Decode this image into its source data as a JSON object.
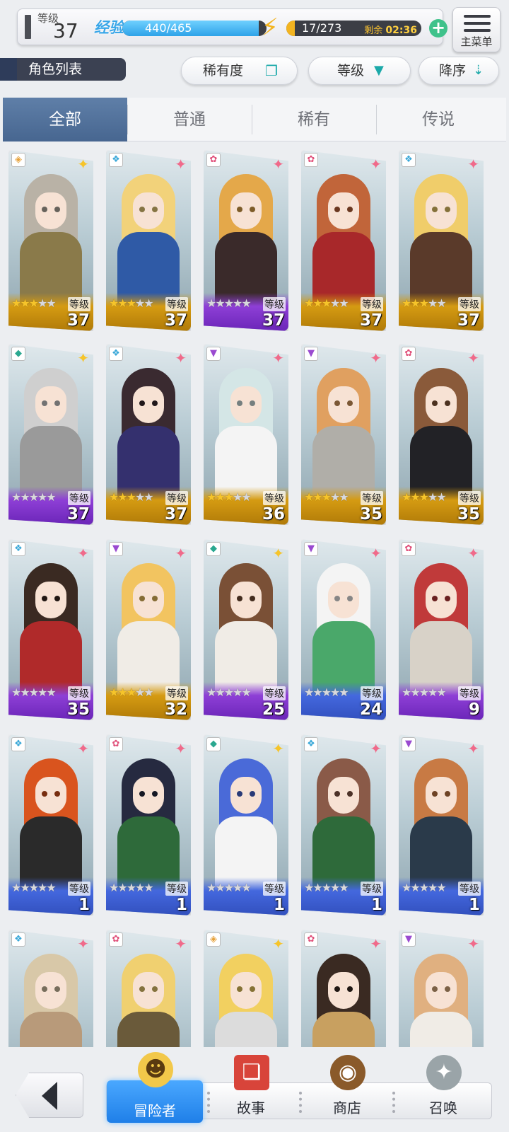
{
  "status": {
    "level_label": "等级",
    "level_value": "37",
    "exp_label": "经验",
    "exp_text": "440/465",
    "exp_fraction": 0.946,
    "stamina_text": "17/273",
    "stamina_fraction": 0.062,
    "stamina_remain_label": "剩余",
    "stamina_remain_time": "02:36",
    "add_symbol": "+"
  },
  "menu": {
    "label": "主菜单",
    "icon": "hamburger-icon"
  },
  "toolbar": {
    "section_label": "角色列表",
    "rarity_label": "稀有度",
    "level_sort_label": "等级",
    "order_label": "降序"
  },
  "tabs": [
    {
      "label": "全部",
      "active": true
    },
    {
      "label": "普通",
      "active": false
    },
    {
      "label": "稀有",
      "active": false
    },
    {
      "label": "传说",
      "active": false
    }
  ],
  "card_level_label": "等级",
  "cards": [
    {
      "level": "37",
      "stars": 3,
      "frame": "rare",
      "element": "earth",
      "hair": "#b9b2a6",
      "outfit": "#8a7a4a"
    },
    {
      "level": "37",
      "stars": 3,
      "frame": "rare",
      "element": "water",
      "hair": "#f2d27a",
      "outfit": "#2f5aa6"
    },
    {
      "level": "37",
      "stars": 0,
      "frame": "legend",
      "element": "fire",
      "hair": "#e4a84a",
      "outfit": "#3a2a2a"
    },
    {
      "level": "37",
      "stars": 3,
      "frame": "rare",
      "element": "fire",
      "hair": "#c1653a",
      "outfit": "#a8282a"
    },
    {
      "level": "37",
      "stars": 3,
      "frame": "rare",
      "element": "water",
      "hair": "#f0cd6a",
      "outfit": "#5a3a2a"
    },
    {
      "level": "37",
      "stars": 0,
      "frame": "legend",
      "element": "wind",
      "hair": "#cfcfcf",
      "outfit": "#9a9a9a"
    },
    {
      "level": "37",
      "stars": 3,
      "frame": "rare",
      "element": "water",
      "hair": "#3a2a30",
      "outfit": "#34306e"
    },
    {
      "level": "36",
      "stars": 3,
      "frame": "rare",
      "element": "dark",
      "hair": "#d4e6e6",
      "outfit": "#f4f4f4"
    },
    {
      "level": "35",
      "stars": 3,
      "frame": "rare",
      "element": "dark",
      "hair": "#e0a060",
      "outfit": "#b0aea8"
    },
    {
      "level": "35",
      "stars": 3,
      "frame": "rare",
      "element": "fire",
      "hair": "#8a5a3a",
      "outfit": "#222226"
    },
    {
      "level": "35",
      "stars": 0,
      "frame": "legend",
      "element": "water",
      "hair": "#3a2a22",
      "outfit": "#b02a2a"
    },
    {
      "level": "32",
      "stars": 3,
      "frame": "rare",
      "element": "dark",
      "hair": "#f2c460",
      "outfit": "#f0ece6"
    },
    {
      "level": "25",
      "stars": 0,
      "frame": "legend",
      "element": "wind",
      "hair": "#7a5036",
      "outfit": "#f0ece6"
    },
    {
      "level": "24",
      "stars": 0,
      "frame": "blue",
      "element": "dark",
      "hair": "#f4f4f4",
      "outfit": "#4aa86a"
    },
    {
      "level": "9",
      "stars": 0,
      "frame": "legend",
      "element": "fire",
      "hair": "#c03a3a",
      "outfit": "#d8d2c8"
    },
    {
      "level": "1",
      "stars": 0,
      "frame": "blue",
      "element": "water",
      "hair": "#d9541e",
      "outfit": "#2a2a2a"
    },
    {
      "level": "1",
      "stars": 0,
      "frame": "blue",
      "element": "fire",
      "hair": "#262a40",
      "outfit": "#2e6a3a"
    },
    {
      "level": "1",
      "stars": 0,
      "frame": "blue",
      "element": "wind",
      "hair": "#4a6ad8",
      "outfit": "#f4f4f4"
    },
    {
      "level": "1",
      "stars": 0,
      "frame": "blue",
      "element": "water",
      "hair": "#8a5a48",
      "outfit": "#2e6a3a"
    },
    {
      "level": "1",
      "stars": 0,
      "frame": "blue",
      "element": "dark",
      "hair": "#c87a44",
      "outfit": "#2a3a4a"
    },
    {
      "level": "",
      "stars": 0,
      "frame": "blue",
      "element": "water",
      "hair": "#d8c8a8",
      "outfit": "#b89a7a"
    },
    {
      "level": "",
      "stars": 0,
      "frame": "blue",
      "element": "fire",
      "hair": "#f0d070",
      "outfit": "#6a5a3a"
    },
    {
      "level": "",
      "stars": 0,
      "frame": "blue",
      "element": "earth",
      "hair": "#f2d060",
      "outfit": "#dcdcdc"
    },
    {
      "level": "",
      "stars": 0,
      "frame": "blue",
      "element": "fire",
      "hair": "#3a2a22",
      "outfit": "#c8a060"
    },
    {
      "level": "",
      "stars": 0,
      "frame": "blue",
      "element": "dark",
      "hair": "#e0b080",
      "outfit": "#f0ece6"
    }
  ],
  "element_icons": {
    "earth": "◈",
    "water": "❖",
    "fire": "✿",
    "wind": "◆",
    "dark": "▼"
  },
  "element_colors": {
    "earth": "#e6a23c",
    "water": "#3aa8d8",
    "fire": "#e0507a",
    "wind": "#2aa890",
    "dark": "#9a4ad0"
  },
  "bottom_nav": {
    "back_icon": "back-arrow-icon",
    "items": [
      {
        "label": "冒险者",
        "active": true,
        "icon": "adventurer-icon"
      },
      {
        "label": "故事",
        "active": false,
        "icon": "book-icon"
      },
      {
        "label": "商店",
        "active": false,
        "icon": "shop-bag-icon"
      },
      {
        "label": "召唤",
        "active": false,
        "icon": "summon-icon"
      }
    ]
  },
  "colors": {
    "accent_blue": "#2ea3e8",
    "stamina_gold": "#f3b420",
    "tab_active": "#476690",
    "add_green": "#3fc28b"
  }
}
